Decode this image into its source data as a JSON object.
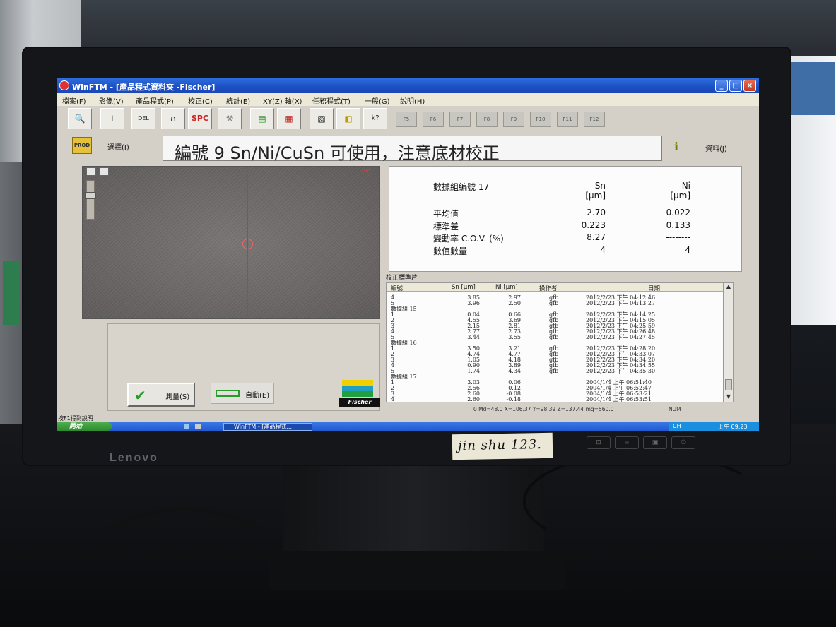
{
  "window": {
    "title": "WinFTM - [產品程式資料夾 -Fischer]",
    "min": "_",
    "max": "□",
    "close": "×"
  },
  "menu": [
    "檔案(F)",
    "影像(V)",
    "產品程式(P)",
    "校正(C)",
    "統計(E)",
    "XY(Z) 軸(X)",
    "任務程式(T)",
    "一般(G)",
    "說明(H)"
  ],
  "toolbar": {
    "spc_label": "SPC",
    "del_label": "DEL",
    "help_label": "k?",
    "fkeys": [
      "F5",
      "F6",
      "F7",
      "F8",
      "F9",
      "F10",
      "F11",
      "F12"
    ]
  },
  "infobar": {
    "prod_label": "PROD",
    "select_label": "選擇(I)",
    "message": "編號 9 Sn/Ni/CuSn 可使用，注意底材校正",
    "info_label": "資料(J)"
  },
  "video": {
    "scale_label": "mm"
  },
  "buttons": {
    "measure": "測量(S)",
    "auto": "自動(E)",
    "logo": "Fischer"
  },
  "stats": {
    "group_label": "數據組編號 17",
    "col1_name": "Sn",
    "col2_name": "Ni",
    "col1_unit": "[μm]",
    "col2_unit": "[μm]",
    "rows": [
      {
        "label": "平均值",
        "v1": "2.70",
        "v2": "-0.022"
      },
      {
        "label": "標準差",
        "v1": "0.223",
        "v2": "0.133"
      },
      {
        "label": "變動率 C.O.V. (%)",
        "v1": "8.27",
        "v2": "--------"
      },
      {
        "label": "數值數量",
        "v1": "4",
        "v2": "4"
      }
    ]
  },
  "table": {
    "title": "校正標準片",
    "headers": [
      "編號",
      "Sn [μm]",
      "Ni [μm]",
      "操作者",
      "日期"
    ],
    "rows": [
      [
        "4",
        "3.85",
        "2.97",
        "gfb",
        "2012/2/23 下午 04:12:46"
      ],
      [
        "5",
        "3.96",
        "2.50",
        "gfb",
        "2012/2/23 下午 04:13:27"
      ],
      [
        "數據組 15",
        "",
        "",
        "",
        ""
      ],
      [
        "1",
        "0.04",
        "0.66",
        "gfb",
        "2012/2/23 下午 04:14:25"
      ],
      [
        "2",
        "4.55",
        "3.69",
        "gfb",
        "2012/2/23 下午 04:15:05"
      ],
      [
        "3",
        "2.15",
        "2.81",
        "gfb",
        "2012/2/23 下午 04:25:59"
      ],
      [
        "4",
        "2.77",
        "2.73",
        "gfb",
        "2012/2/23 下午 04:26:48"
      ],
      [
        "5",
        "3.44",
        "3.55",
        "gfb",
        "2012/2/23 下午 04:27:45"
      ],
      [
        "數據組 16",
        "",
        "",
        "",
        ""
      ],
      [
        "1",
        "3.50",
        "3.21",
        "gfb",
        "2012/2/23 下午 04:28:20"
      ],
      [
        "2",
        "4.74",
        "4.77",
        "gfb",
        "2012/2/23 下午 04:33:07"
      ],
      [
        "3",
        "1.05",
        "4.18",
        "gfb",
        "2012/2/23 下午 04:34:20"
      ],
      [
        "4",
        "0.90",
        "3.89",
        "gfb",
        "2012/2/23 下午 04:34:55"
      ],
      [
        "5",
        "1.74",
        "4.34",
        "gfb",
        "2012/2/23 下午 04:35:30"
      ],
      [
        "數據組 17",
        "",
        "",
        "",
        ""
      ],
      [
        "1",
        "3.03",
        "0.06",
        "",
        "2004/1/4 上午 06:51:40"
      ],
      [
        "2",
        "2.56",
        "0.12",
        "",
        "2004/1/4 上午 06:52:47"
      ],
      [
        "3",
        "2.60",
        "-0.08",
        "",
        "2004/1/4 上午 06:53:21"
      ],
      [
        "4",
        "2.60",
        "-0.18",
        "",
        "2004/1/4 上午 06:53:51"
      ]
    ]
  },
  "status": {
    "coords": "0  Md=48.0  X=106.37  Y=98.39  Z=137.44  mq=560.0",
    "num": "NUM",
    "hint": "按F1得到說明"
  },
  "taskbar": {
    "start": "開始",
    "task": "WinFTM - [產品程式...",
    "lang": "CH",
    "clock": "上午 09:23"
  },
  "monitor": {
    "brand": "Lenovo",
    "tape_label": "jin shu 123."
  }
}
